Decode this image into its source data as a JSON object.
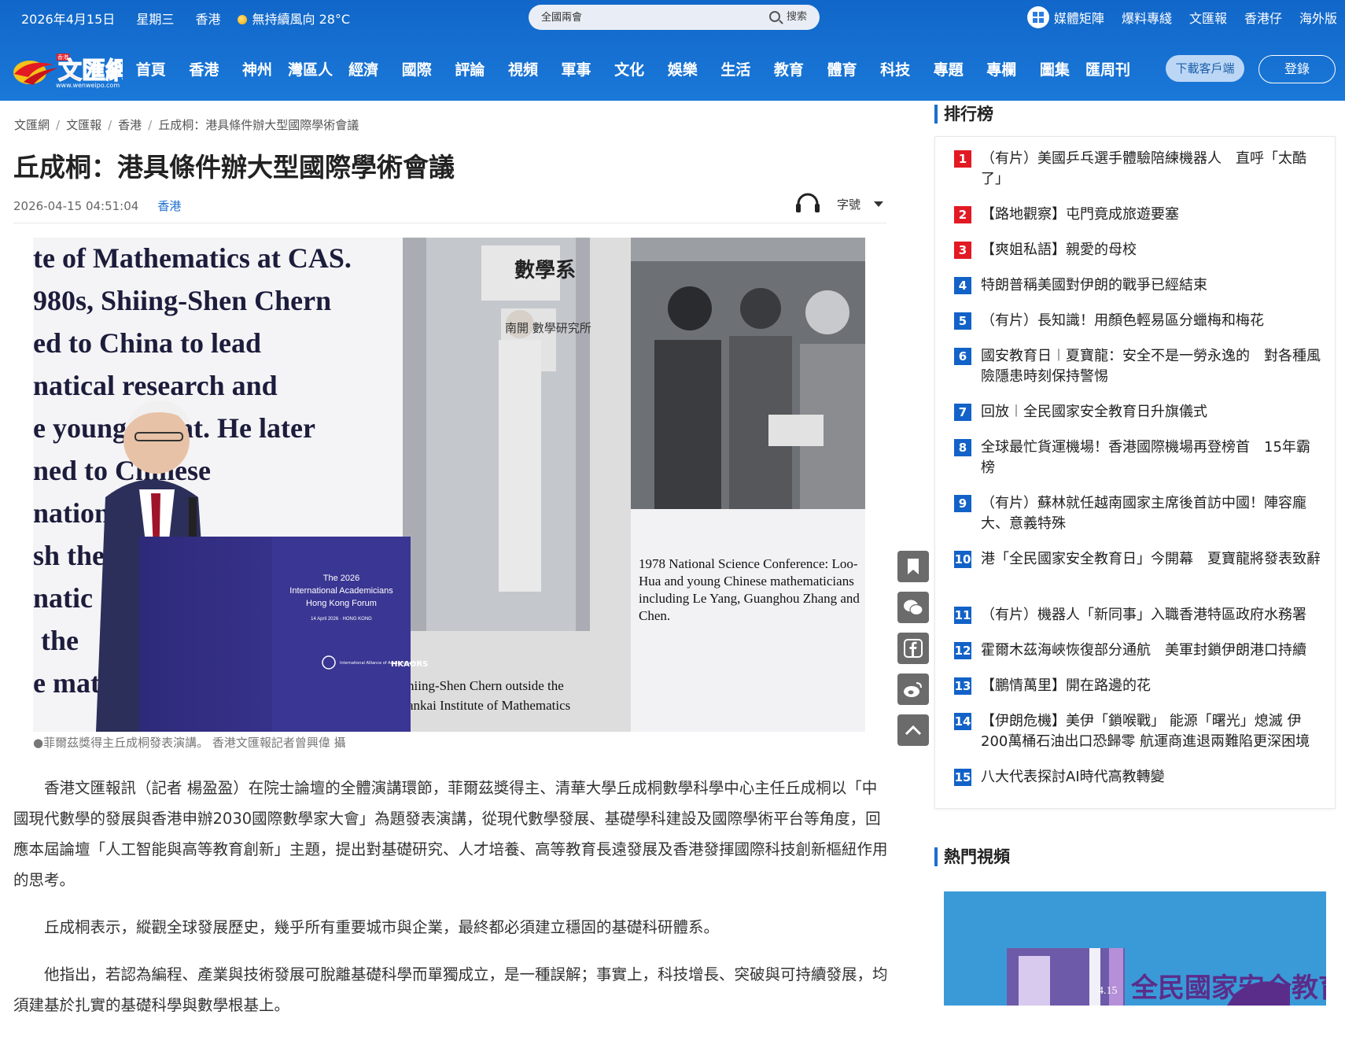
{
  "topbar": {
    "date": "2026年4月15日",
    "weekday": "星期三",
    "weather": "香港",
    "weather_desc": "無持續風向 28°C",
    "search_placeholder": "全國兩會",
    "search_label": "搜索",
    "links": [
      "媒體矩陣",
      "爆料專綫",
      "文匯報",
      "香港仔",
      "海外版"
    ]
  },
  "logo": {
    "text": "文匯網",
    "small": "香港",
    "site": "www.wenweipo.com"
  },
  "nav": {
    "items": [
      "首頁",
      "香港",
      "神州",
      "灣區人",
      "經濟",
      "國際",
      "評論",
      "視頻",
      "軍事",
      "文化",
      "娛樂",
      "生活",
      "教育",
      "體育",
      "科技",
      "專題",
      "專欄",
      "圖集",
      "匯周刊"
    ],
    "download": "下載客戶端",
    "login": "登錄"
  },
  "breadcrumb": [
    "文匯網",
    "文匯報",
    "香港",
    "丘成桐：港具條件辦大型國際學術會議"
  ],
  "article": {
    "title": "丘成桐：港具條件辦大型國際學術會議",
    "datetime": "2026-04-15 04:51:04",
    "category": "香港",
    "fontsize_label": "字號",
    "caption": "●菲爾茲獎得主丘成桐發表演講。 香港文匯報記者曾興偉 攝",
    "paragraphs": [
      "香港文匯報訊（記者 楊盈盈）在院士論壇的全體演講環節，菲爾茲獎得主、清華大學丘成桐數學科學中心主任丘成桐以「中國現代數學的發展與香港申辦2030國際數學家大會」為題發表演講，從現代數學發展、基礎學科建設及國際學術平台等角度，回應本屆論壇「人工智能與高等教育創新」主題，提出對基礎研究、人才培養、高等教育長遠發展及香港發揮國際科技創新樞紐作用的思考。",
      "丘成桐表示，縱觀全球發展歷史，幾乎所有重要城市與企業，最終都必須建立穩固的基礎科研體系。",
      "他指出，若認為編程、產業與技術發展可脫離基礎科學而單獨成立，是一種誤解；事實上，科技增長、突破與可持續發展，均須建基於扎實的基礎科學與數學根基上。"
    ]
  },
  "photo": {
    "slide_lines": [
      "te of Mathematics at CAS.",
      "980s, Shiing-Shen Chern",
      "ed to China to lead",
      "natical research and",
      "e young talent. He later",
      "ned to Chinese",
      "nation",
      "sh the",
      "natic",
      "the",
      "e mat"
    ],
    "slide_sign1": "數學系",
    "slide_sign2": "南開 數學研究所",
    "slide_caption_right": [
      "1978 National Science Conference: Loo-",
      "Hua and young Chinese mathematicians",
      "including Le Yang, Guanghou Zhang and",
      "Chen."
    ],
    "slide_caption_bottom": [
      "hiing-Shen Chern outside the",
      "ankai Institute of Mathematics"
    ],
    "podium_lines": [
      "The 2026",
      "International Academicians",
      "Hong Kong Forum"
    ],
    "podium_date": "14 April 2026 · HONG KONG",
    "podium_logo1": "International Alliance of Academicians",
    "podium_logo2": "HKAORS"
  },
  "sidebar": {
    "ranking_title": "排行榜",
    "ranking": [
      {
        "num": "1",
        "text": "（有片）美國乒乓選手體驗陪練機器人　直呼「太酷了」"
      },
      {
        "num": "2",
        "text": "【路地觀察】屯門竟成旅遊要塞"
      },
      {
        "num": "3",
        "text": "【爽姐私語】親愛的母校"
      },
      {
        "num": "4",
        "text": "特朗普稱美國對伊朗的戰爭已經結束"
      },
      {
        "num": "5",
        "text": "（有片）長知識！用顏色輕易區分蠟梅和梅花"
      },
      {
        "num": "6",
        "text": "國安教育日︱夏寶龍：安全不是一勞永逸的　對各種風險隱患時刻保持警惕"
      },
      {
        "num": "7",
        "text": "回放︱全民國家安全教育日升旗儀式"
      },
      {
        "num": "8",
        "text": "全球最忙貨運機場！香港國際機場再登榜首　15年霸榜"
      },
      {
        "num": "9",
        "text": "（有片）蘇林就任越南國家主席後首訪中國！陣容龐大、意義特殊"
      },
      {
        "num": "10",
        "text": "港「全民國家安全教育日」今開幕　夏寶龍將發表致辭"
      },
      {
        "num": "11",
        "text": "（有片）機器人「新同事」入職香港特區政府水務署"
      },
      {
        "num": "12",
        "text": "霍爾木茲海峽恢復部分通航　美軍封鎖伊朗港口持續"
      },
      {
        "num": "13",
        "text": "【鵬情萬里】開在路邊的花"
      },
      {
        "num": "14",
        "text": "【伊朗危機】美伊「鎖喉戰」 能源「曙光」熄滅 伊200萬桶石油出口恐歸零 航運商進退兩難陷更深困境"
      },
      {
        "num": "15",
        "text": "八大代表探討AI時代高教轉變"
      }
    ],
    "video_title": "熱門視頻",
    "video_banner": "全民國家安全教育日",
    "video_date": "4.15"
  },
  "colors": {
    "brand_blue": "#1a72d6",
    "rank_red": "#e21a23",
    "rank_blue": "#1262c8"
  }
}
